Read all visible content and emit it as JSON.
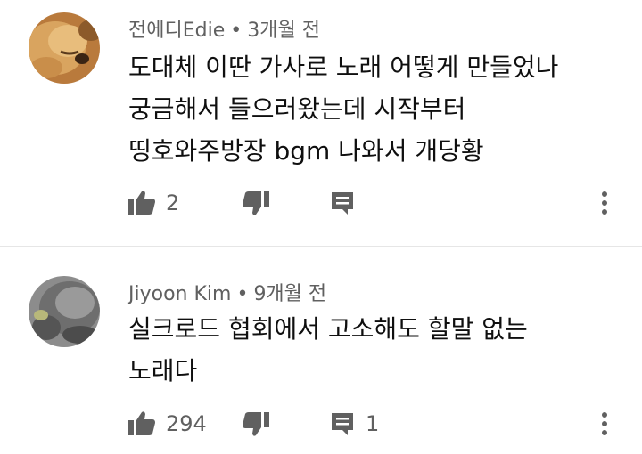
{
  "comments": [
    {
      "author": "전에디Edie",
      "time": "3개월 전",
      "lines": [
        "도대체 이딴 가사로 노래 어떻게 만들었나",
        "궁금해서 들으러왔는데 시작부터",
        "띵호와주방장 bgm 나와서 개당황"
      ],
      "likes": "2",
      "replies": ""
    },
    {
      "author": "Jiyoon Kim",
      "time": "9개월 전",
      "lines": [
        "실크로드 협회에서 고소해도 할말 없는",
        "노래다"
      ],
      "likes": "294",
      "replies": "1"
    }
  ],
  "separator": "•",
  "icons": [
    "thumbs-up-icon",
    "thumbs-down-icon",
    "reply-icon",
    "more-vert-icon"
  ],
  "colors": {
    "text": "#0f0f0f",
    "secondary": "#606060",
    "divider": "#e6e6e6"
  }
}
